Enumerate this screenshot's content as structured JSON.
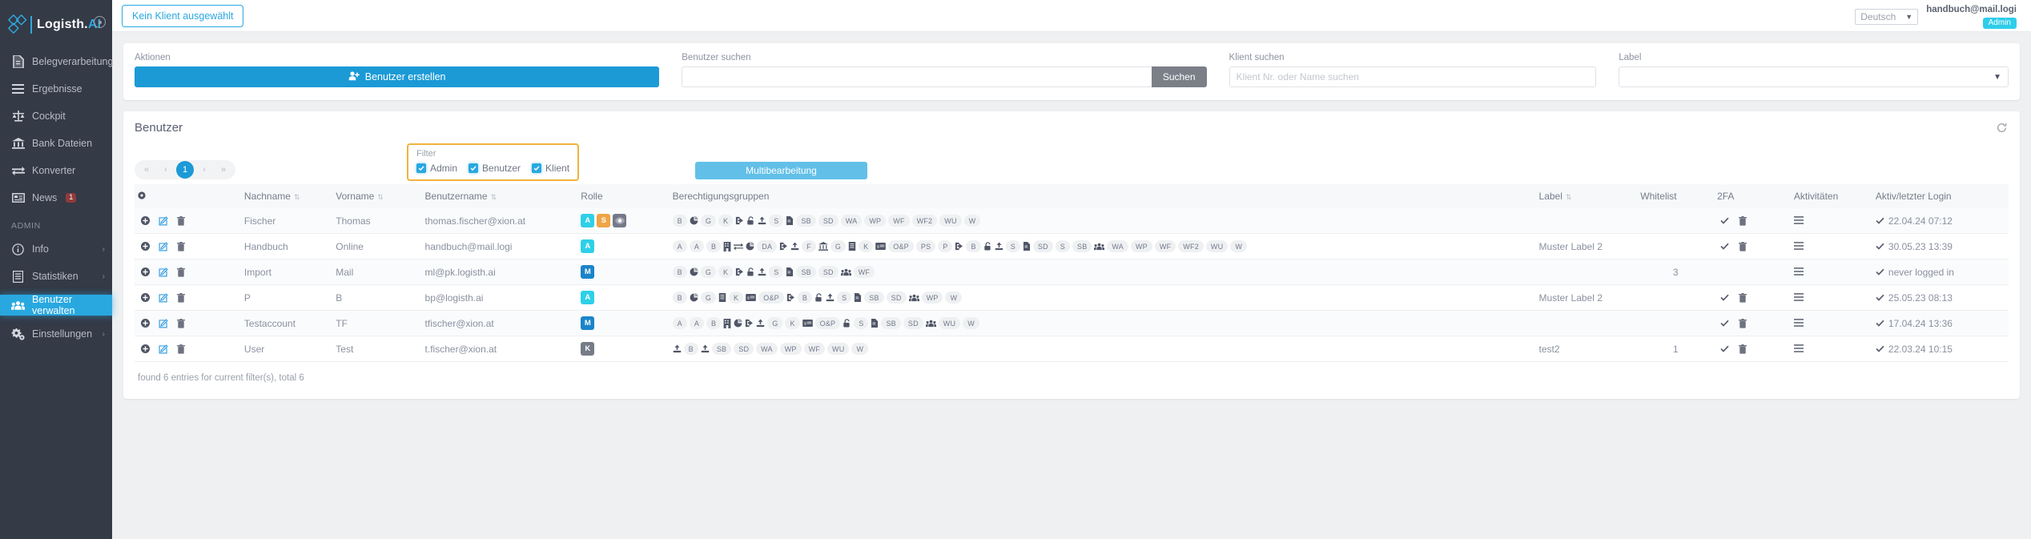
{
  "sidebar": {
    "brand": {
      "name": "Logisth.",
      "suffix": "AI"
    },
    "collapse_icon": "collapse-toggle-icon",
    "items": [
      {
        "label": "Belegverarbeitung",
        "icon": "document-icon"
      },
      {
        "label": "Ergebnisse",
        "icon": "list-icon"
      },
      {
        "label": "Cockpit",
        "icon": "scale-icon"
      },
      {
        "label": "Bank Dateien",
        "icon": "bank-icon"
      },
      {
        "label": "Konverter",
        "icon": "exchange-icon"
      },
      {
        "label": "News",
        "icon": "news-icon",
        "badge": "1"
      }
    ],
    "section_label": "ADMIN",
    "admin_items": [
      {
        "label": "Info",
        "icon": "info-icon",
        "chevron": "›"
      },
      {
        "label": "Statistiken",
        "icon": "chart-book-icon",
        "chevron": "›"
      },
      {
        "label": "Benutzer verwalten",
        "icon": "users-icon",
        "active": true
      },
      {
        "label": "Einstellungen",
        "icon": "gears-icon",
        "chevron": "›"
      }
    ]
  },
  "topbar": {
    "client_button": "Kein Klient ausgewählt",
    "language": "Deutsch",
    "user_email": "handbuch@mail.logi",
    "user_role": "Admin"
  },
  "actions": {
    "aktionen_label": "Aktionen",
    "create_user_button": "Benutzer erstellen",
    "user_search_label": "Benutzer suchen",
    "user_search_value": "",
    "user_search_placeholder": "",
    "search_button": "Suchen",
    "client_search_label": "Klient suchen",
    "client_search_placeholder": "Klient Nr. oder Name suchen",
    "client_search_value": "",
    "label_label": "Label",
    "label_value": ""
  },
  "users": {
    "title": "Benutzer",
    "refresh_icon": "refresh-icon",
    "pager": {
      "first": "«",
      "prev": "‹",
      "current": "1",
      "next": "›",
      "last": "»"
    },
    "filter": {
      "legend": "Filter",
      "options": [
        {
          "label": "Admin",
          "checked": true
        },
        {
          "label": "Benutzer",
          "checked": true
        },
        {
          "label": "Klient",
          "checked": true
        }
      ]
    },
    "multi_edit_button": "Multibearbeitung",
    "columns": [
      {
        "key": "actions",
        "label": "",
        "sortable": false
      },
      {
        "key": "nachname",
        "label": "Nachname",
        "sortable": true
      },
      {
        "key": "vorname",
        "label": "Vorname",
        "sortable": true
      },
      {
        "key": "benutzername",
        "label": "Benutzername",
        "sortable": true
      },
      {
        "key": "rolle",
        "label": "Rolle",
        "sortable": false
      },
      {
        "key": "berechtigungsgruppen",
        "label": "Berechtigungsgruppen",
        "sortable": false
      },
      {
        "key": "label",
        "label": "Label",
        "sortable": true
      },
      {
        "key": "whitelist",
        "label": "Whitelist",
        "sortable": false
      },
      {
        "key": "zfa",
        "label": "2FA",
        "sortable": false
      },
      {
        "key": "aktivitaeten",
        "label": "Aktivitäten",
        "sortable": false
      },
      {
        "key": "aktiv",
        "label": "Aktiv/letzter Login",
        "sortable": false
      }
    ],
    "rows": [
      {
        "nachname": "Fischer",
        "vorname": "Thomas",
        "benutzername": "thomas.fischer@xion.at",
        "roles": [
          {
            "letter": "A",
            "kind": "A"
          },
          {
            "letter": "S",
            "kind": "S"
          },
          {
            "letter": "",
            "kind": "E",
            "icon": "eye-icon"
          }
        ],
        "perms": [
          {
            "t": "text",
            "v": "B"
          },
          {
            "t": "icon",
            "v": "pie-icon"
          },
          {
            "t": "text",
            "v": "G"
          },
          {
            "t": "text",
            "v": "K"
          },
          {
            "t": "icon",
            "v": "import-icon"
          },
          {
            "t": "icon",
            "v": "unlock-icon"
          },
          {
            "t": "icon",
            "v": "upload-icon"
          },
          {
            "t": "text",
            "v": "S"
          },
          {
            "t": "icon",
            "v": "file-icon"
          },
          {
            "t": "text",
            "v": "SB"
          },
          {
            "t": "text",
            "v": "SD"
          },
          {
            "t": "text",
            "v": "WA"
          },
          {
            "t": "text",
            "v": "WP"
          },
          {
            "t": "text",
            "v": "WF"
          },
          {
            "t": "text",
            "v": "WF2"
          },
          {
            "t": "text",
            "v": "WU"
          },
          {
            "t": "text",
            "v": "W"
          }
        ],
        "label": "",
        "whitelist": "",
        "zfa_check": true,
        "zfa_trash": true,
        "activities": true,
        "active_check": true,
        "last_login": "22.04.24 07:12"
      },
      {
        "nachname": "Handbuch",
        "vorname": "Online",
        "benutzername": "handbuch@mail.logi",
        "roles": [
          {
            "letter": "A",
            "kind": "A"
          }
        ],
        "perms": [
          {
            "t": "text",
            "v": "A"
          },
          {
            "t": "text",
            "v": "A"
          },
          {
            "t": "text",
            "v": "B"
          },
          {
            "t": "icon",
            "v": "building-icon"
          },
          {
            "t": "icon",
            "v": "exchange-icon"
          },
          {
            "t": "icon",
            "v": "pie-icon"
          },
          {
            "t": "text",
            "v": "DA"
          },
          {
            "t": "icon",
            "v": "import-icon"
          },
          {
            "t": "icon",
            "v": "upload-icon"
          },
          {
            "t": "text",
            "v": "F"
          },
          {
            "t": "icon",
            "v": "bank-icon"
          },
          {
            "t": "text",
            "v": "G"
          },
          {
            "t": "icon",
            "v": "book-icon"
          },
          {
            "t": "text",
            "v": "K"
          },
          {
            "t": "icon",
            "v": "card-icon"
          },
          {
            "t": "text",
            "v": "O&P"
          },
          {
            "t": "text",
            "v": "PS"
          },
          {
            "t": "text",
            "v": "P"
          },
          {
            "t": "icon",
            "v": "import-icon"
          },
          {
            "t": "text",
            "v": "B"
          },
          {
            "t": "icon",
            "v": "unlock-icon"
          },
          {
            "t": "icon",
            "v": "upload-icon"
          },
          {
            "t": "text",
            "v": "S"
          },
          {
            "t": "icon",
            "v": "file-icon"
          },
          {
            "t": "text",
            "v": "SD"
          },
          {
            "t": "text",
            "v": "S"
          },
          {
            "t": "text",
            "v": "SB"
          },
          {
            "t": "icon",
            "v": "users-icon"
          },
          {
            "t": "text",
            "v": "WA"
          },
          {
            "t": "text",
            "v": "WP"
          },
          {
            "t": "text",
            "v": "WF"
          },
          {
            "t": "text",
            "v": "WF2"
          },
          {
            "t": "text",
            "v": "WU"
          },
          {
            "t": "text",
            "v": "W"
          }
        ],
        "label": "Muster Label 2",
        "whitelist": "",
        "zfa_check": true,
        "zfa_trash": true,
        "activities": true,
        "active_check": true,
        "last_login": "30.05.23 13:39"
      },
      {
        "nachname": "Import",
        "vorname": "Mail",
        "benutzername": "ml@pk.logisth.ai",
        "roles": [
          {
            "letter": "M",
            "kind": "M"
          }
        ],
        "perms": [
          {
            "t": "text",
            "v": "B"
          },
          {
            "t": "icon",
            "v": "pie-icon"
          },
          {
            "t": "text",
            "v": "G"
          },
          {
            "t": "text",
            "v": "K"
          },
          {
            "t": "icon",
            "v": "import-icon"
          },
          {
            "t": "icon",
            "v": "unlock-icon"
          },
          {
            "t": "icon",
            "v": "upload-icon"
          },
          {
            "t": "text",
            "v": "S"
          },
          {
            "t": "icon",
            "v": "file-icon"
          },
          {
            "t": "text",
            "v": "SB"
          },
          {
            "t": "text",
            "v": "SD"
          },
          {
            "t": "icon",
            "v": "users-icon"
          },
          {
            "t": "text",
            "v": "WF"
          }
        ],
        "label": "",
        "whitelist": "3",
        "zfa_check": false,
        "zfa_trash": false,
        "activities": true,
        "active_check": true,
        "last_login": "never logged in"
      },
      {
        "nachname": "P",
        "vorname": "B",
        "benutzername": "bp@logisth.ai",
        "roles": [
          {
            "letter": "A",
            "kind": "A"
          }
        ],
        "perms": [
          {
            "t": "text",
            "v": "B"
          },
          {
            "t": "icon",
            "v": "pie-icon"
          },
          {
            "t": "text",
            "v": "G"
          },
          {
            "t": "icon",
            "v": "book-icon"
          },
          {
            "t": "text",
            "v": "K"
          },
          {
            "t": "icon",
            "v": "card-icon"
          },
          {
            "t": "text",
            "v": "O&P"
          },
          {
            "t": "icon",
            "v": "import-icon"
          },
          {
            "t": "text",
            "v": "B"
          },
          {
            "t": "icon",
            "v": "unlock-icon"
          },
          {
            "t": "icon",
            "v": "upload-icon"
          },
          {
            "t": "text",
            "v": "S"
          },
          {
            "t": "icon",
            "v": "file-icon"
          },
          {
            "t": "text",
            "v": "SB"
          },
          {
            "t": "text",
            "v": "SD"
          },
          {
            "t": "icon",
            "v": "users-icon"
          },
          {
            "t": "text",
            "v": "WP"
          },
          {
            "t": "text",
            "v": "W"
          }
        ],
        "label": "Muster Label 2",
        "whitelist": "",
        "zfa_check": true,
        "zfa_trash": true,
        "activities": true,
        "active_check": true,
        "last_login": "25.05.23 08:13"
      },
      {
        "nachname": "Testaccount",
        "vorname": "TF",
        "benutzername": "tfischer@xion.at",
        "roles": [
          {
            "letter": "M",
            "kind": "M"
          }
        ],
        "perms": [
          {
            "t": "text",
            "v": "A"
          },
          {
            "t": "text",
            "v": "A"
          },
          {
            "t": "text",
            "v": "B"
          },
          {
            "t": "icon",
            "v": "building-icon"
          },
          {
            "t": "icon",
            "v": "pie-icon"
          },
          {
            "t": "icon",
            "v": "import-icon"
          },
          {
            "t": "icon",
            "v": "upload-icon"
          },
          {
            "t": "text",
            "v": "G"
          },
          {
            "t": "text",
            "v": "K"
          },
          {
            "t": "icon",
            "v": "card-icon"
          },
          {
            "t": "text",
            "v": "O&P"
          },
          {
            "t": "icon",
            "v": "unlock-icon"
          },
          {
            "t": "text",
            "v": "S"
          },
          {
            "t": "icon",
            "v": "file-icon"
          },
          {
            "t": "text",
            "v": "SB"
          },
          {
            "t": "text",
            "v": "SD"
          },
          {
            "t": "icon",
            "v": "users-icon"
          },
          {
            "t": "text",
            "v": "WU"
          },
          {
            "t": "text",
            "v": "W"
          }
        ],
        "label": "",
        "whitelist": "",
        "zfa_check": true,
        "zfa_trash": true,
        "activities": true,
        "active_check": true,
        "last_login": "17.04.24 13:36"
      },
      {
        "nachname": "User",
        "vorname": "Test",
        "benutzername": "t.fischer@xion.at",
        "roles": [
          {
            "letter": "K",
            "kind": "K"
          }
        ],
        "perms": [
          {
            "t": "icon",
            "v": "upload-icon"
          },
          {
            "t": "text",
            "v": "B"
          },
          {
            "t": "icon",
            "v": "upload-icon"
          },
          {
            "t": "text",
            "v": "SB"
          },
          {
            "t": "text",
            "v": "SD"
          },
          {
            "t": "text",
            "v": "WA"
          },
          {
            "t": "text",
            "v": "WP"
          },
          {
            "t": "text",
            "v": "WF"
          },
          {
            "t": "text",
            "v": "WU"
          },
          {
            "t": "text",
            "v": "W"
          }
        ],
        "label": "test2",
        "whitelist": "1",
        "zfa_check": true,
        "zfa_trash": true,
        "activities": true,
        "active_check": true,
        "last_login": "22.03.24 10:15"
      }
    ],
    "footer": "found 6 entries for current filter(s), total 6"
  },
  "colors": {
    "accent": "#29a8e0",
    "primary_button": "#1b9ad6",
    "multi_button": "#62c0e8",
    "filter_border": "#f0b33c",
    "sidebar_bg": "#343a46",
    "role_admin": "#2ed0e8",
    "role_s": "#f0a446",
    "role_m": "#1b84c9",
    "role_k": "#767b88"
  }
}
